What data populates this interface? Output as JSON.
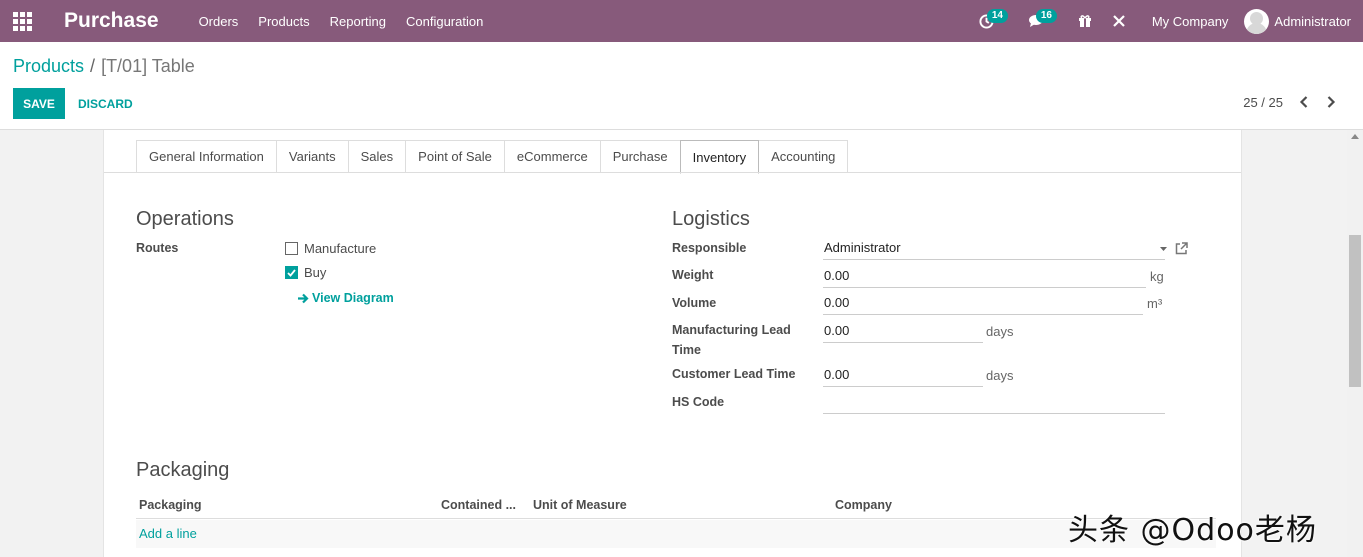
{
  "navbar": {
    "app_name": "Purchase",
    "menu": [
      "Orders",
      "Products",
      "Reporting",
      "Configuration"
    ],
    "activity_count": "14",
    "messages_count": "16",
    "company": "My Company",
    "user": "Administrator"
  },
  "breadcrumb": {
    "parent": "Products",
    "separator": "/",
    "current": "[T/01] Table"
  },
  "buttons": {
    "save": "SAVE",
    "discard": "DISCARD"
  },
  "pager": {
    "value": "25 / 25"
  },
  "tabs": [
    {
      "label": "General Information",
      "active": false
    },
    {
      "label": "Variants",
      "active": false
    },
    {
      "label": "Sales",
      "active": false
    },
    {
      "label": "Point of Sale",
      "active": false
    },
    {
      "label": "eCommerce",
      "active": false
    },
    {
      "label": "Purchase",
      "active": false
    },
    {
      "label": "Inventory",
      "active": true
    },
    {
      "label": "Accounting",
      "active": false
    }
  ],
  "operations": {
    "title": "Operations",
    "routes_label": "Routes",
    "routes": [
      {
        "label": "Manufacture",
        "checked": false
      },
      {
        "label": "Buy",
        "checked": true
      }
    ],
    "view_diagram": "View Diagram"
  },
  "logistics": {
    "title": "Logistics",
    "responsible_label": "Responsible",
    "responsible_value": "Administrator",
    "weight_label": "Weight",
    "weight_value": "0.00",
    "weight_unit": "kg",
    "volume_label": "Volume",
    "volume_value": "0.00",
    "volume_unit": "m³",
    "mlt_label_1": "Manufacturing Lead",
    "mlt_label_2": "Time",
    "mlt_value": "0.00",
    "mlt_unit": "days",
    "clt_label": "Customer Lead Time",
    "clt_value": "0.00",
    "clt_unit": "days",
    "hs_label": "HS Code",
    "hs_value": ""
  },
  "packaging": {
    "title": "Packaging",
    "columns": [
      "Packaging",
      "Contained ...",
      "Unit of Measure",
      "Company"
    ],
    "add_line": "Add a line"
  },
  "watermark": "头条 @Odoo老杨",
  "colors": {
    "navbar": "#875a7b",
    "accent": "#00a09d"
  }
}
